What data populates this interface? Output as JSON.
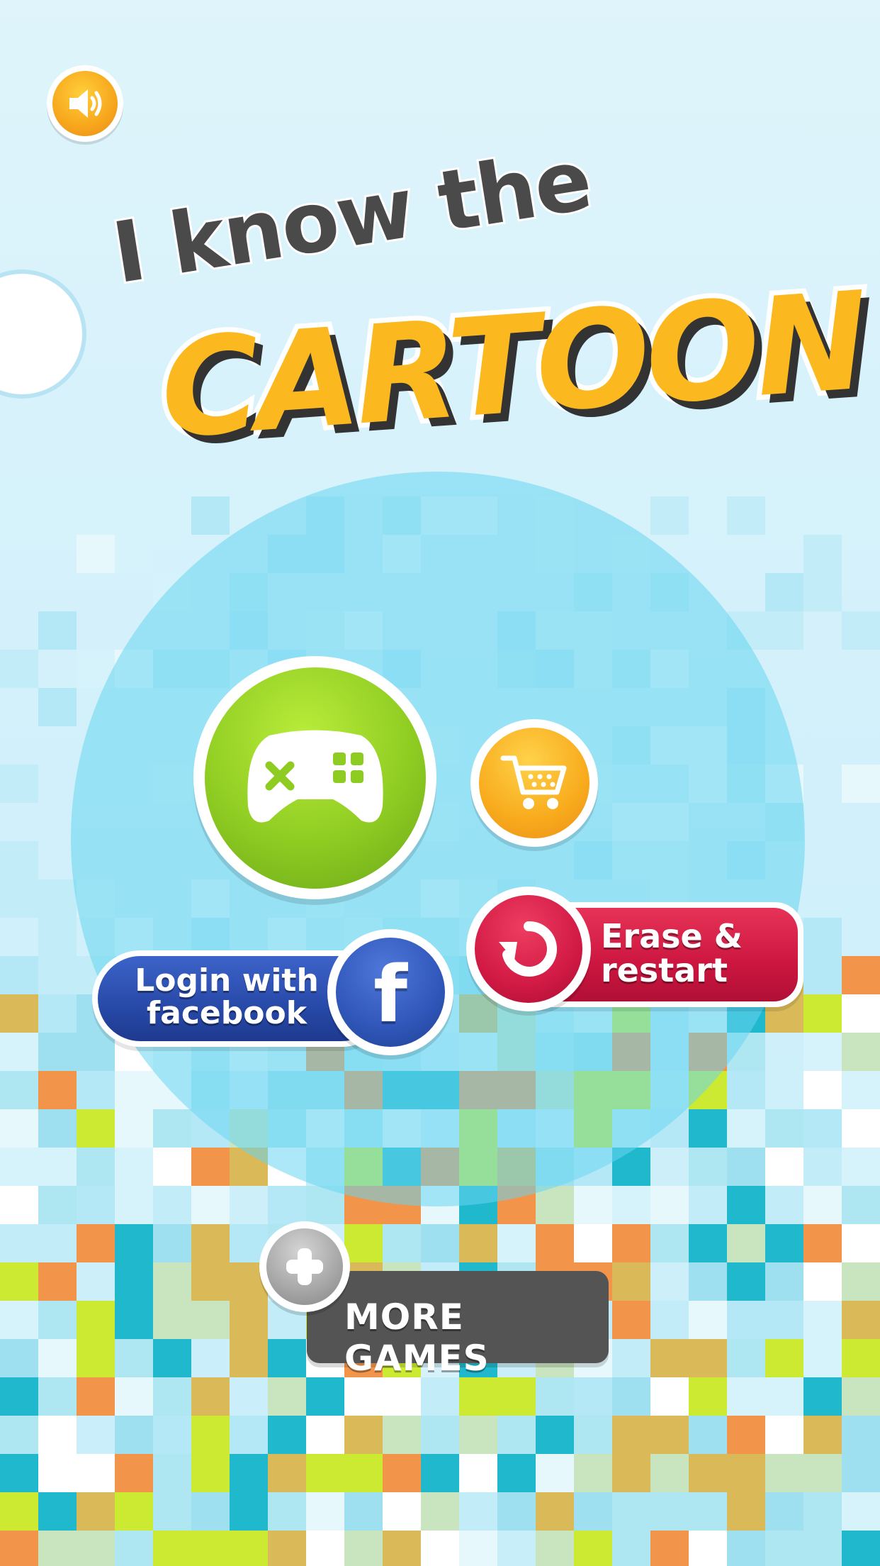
{
  "logo": {
    "line1": "I know the",
    "line2": "CARTOON"
  },
  "buttons": {
    "facebook_label": "Login with facebook",
    "facebook_glyph": "f",
    "erase_label": "Erase & restart",
    "more_games_label": "MORE GAMES"
  },
  "icons": {
    "sound": "speaker-icon",
    "play": "gamepad-icon",
    "shop": "cart-icon",
    "erase": "restart-icon",
    "more": "plus-icon"
  },
  "colors": {
    "play_green": "#8fcc22",
    "orange": "#f7a61c",
    "facebook_blue": "#2749a8",
    "erase_red": "#cc1640",
    "more_gray": "#545454",
    "title_yellow": "#fbb91f"
  }
}
